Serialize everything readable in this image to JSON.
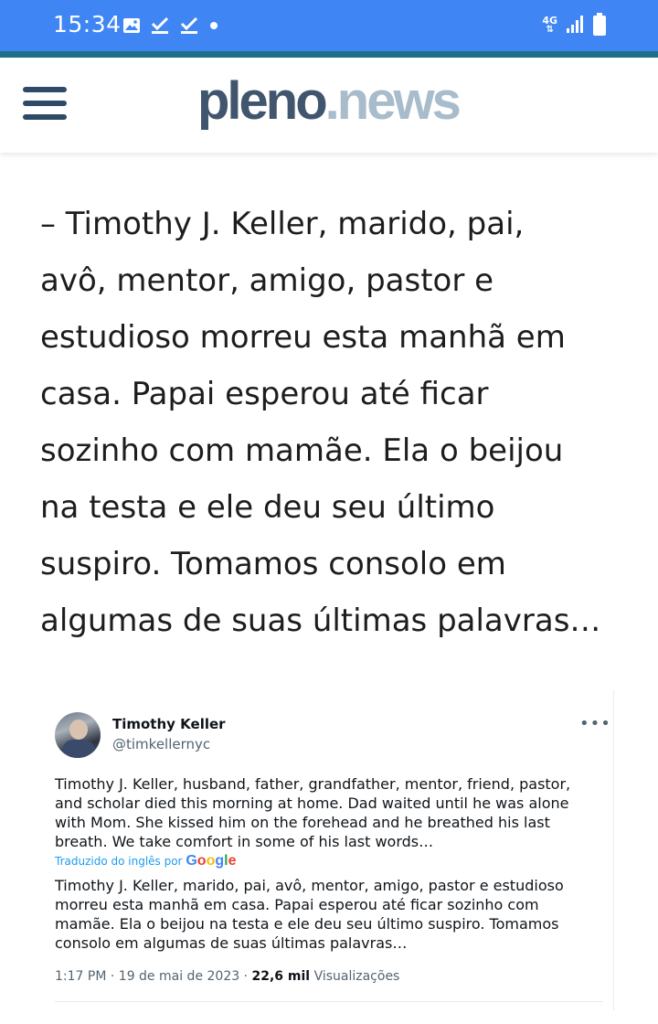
{
  "status_bar": {
    "time": "15:34",
    "network": "4G",
    "left_icons": [
      "image-icon",
      "check-download-icon",
      "check-download-icon",
      "dot-icon"
    ],
    "right_icons": [
      "4g-arrows-icon",
      "signal-icon",
      "battery-icon"
    ],
    "background": "#3f86f4"
  },
  "header": {
    "logo_part1": "pleno",
    "logo_part2": ".news",
    "menu_icon": "hamburger-menu-icon",
    "logo_colors": {
      "dark": "#41566e",
      "light": "#a8bccb"
    }
  },
  "article": {
    "quote_lines": [
      "– Timothy J. Keller, marido, pai,",
      "avô, mentor, amigo, pastor e",
      "estudioso morreu esta manhã em",
      "casa. Papai esperou até ficar",
      "sozinho com mamãe. Ela o beijou",
      "na testa e ele deu seu último",
      "suspiro. Tomamos consolo em",
      "algumas de suas últimas palavras…"
    ]
  },
  "tweet": {
    "author_name": "Timothy Keller",
    "handle": "@timkellernyc",
    "more_label": "•••",
    "original_lines": [
      "Timothy J. Keller, husband, father, grandfather, mentor, friend, pastor,",
      "and scholar died this morning at home. Dad waited until he was alone",
      "with Mom. She kissed him on the forehead and he breathed his last",
      "breath. We take comfort in some of his last words…"
    ],
    "translated_label": "Traduzido do inglês por",
    "google_letters": [
      "G",
      "o",
      "o",
      "g",
      "l",
      "e"
    ],
    "translated_lines": [
      "Timothy J. Keller, marido, pai, avô, mentor, amigo, pastor e estudioso",
      "morreu esta manhã em casa. Papai esperou até ficar sozinho com",
      "mamãe. Ela o beijou na testa e ele deu seu último suspiro. Tomamos",
      "consolo em algumas de suas últimas palavras…"
    ],
    "time": "1:17 PM",
    "separator": "·",
    "date": "19 de mai de 2023",
    "views_count": "22,6 mil",
    "views_label": "Visualizações"
  }
}
